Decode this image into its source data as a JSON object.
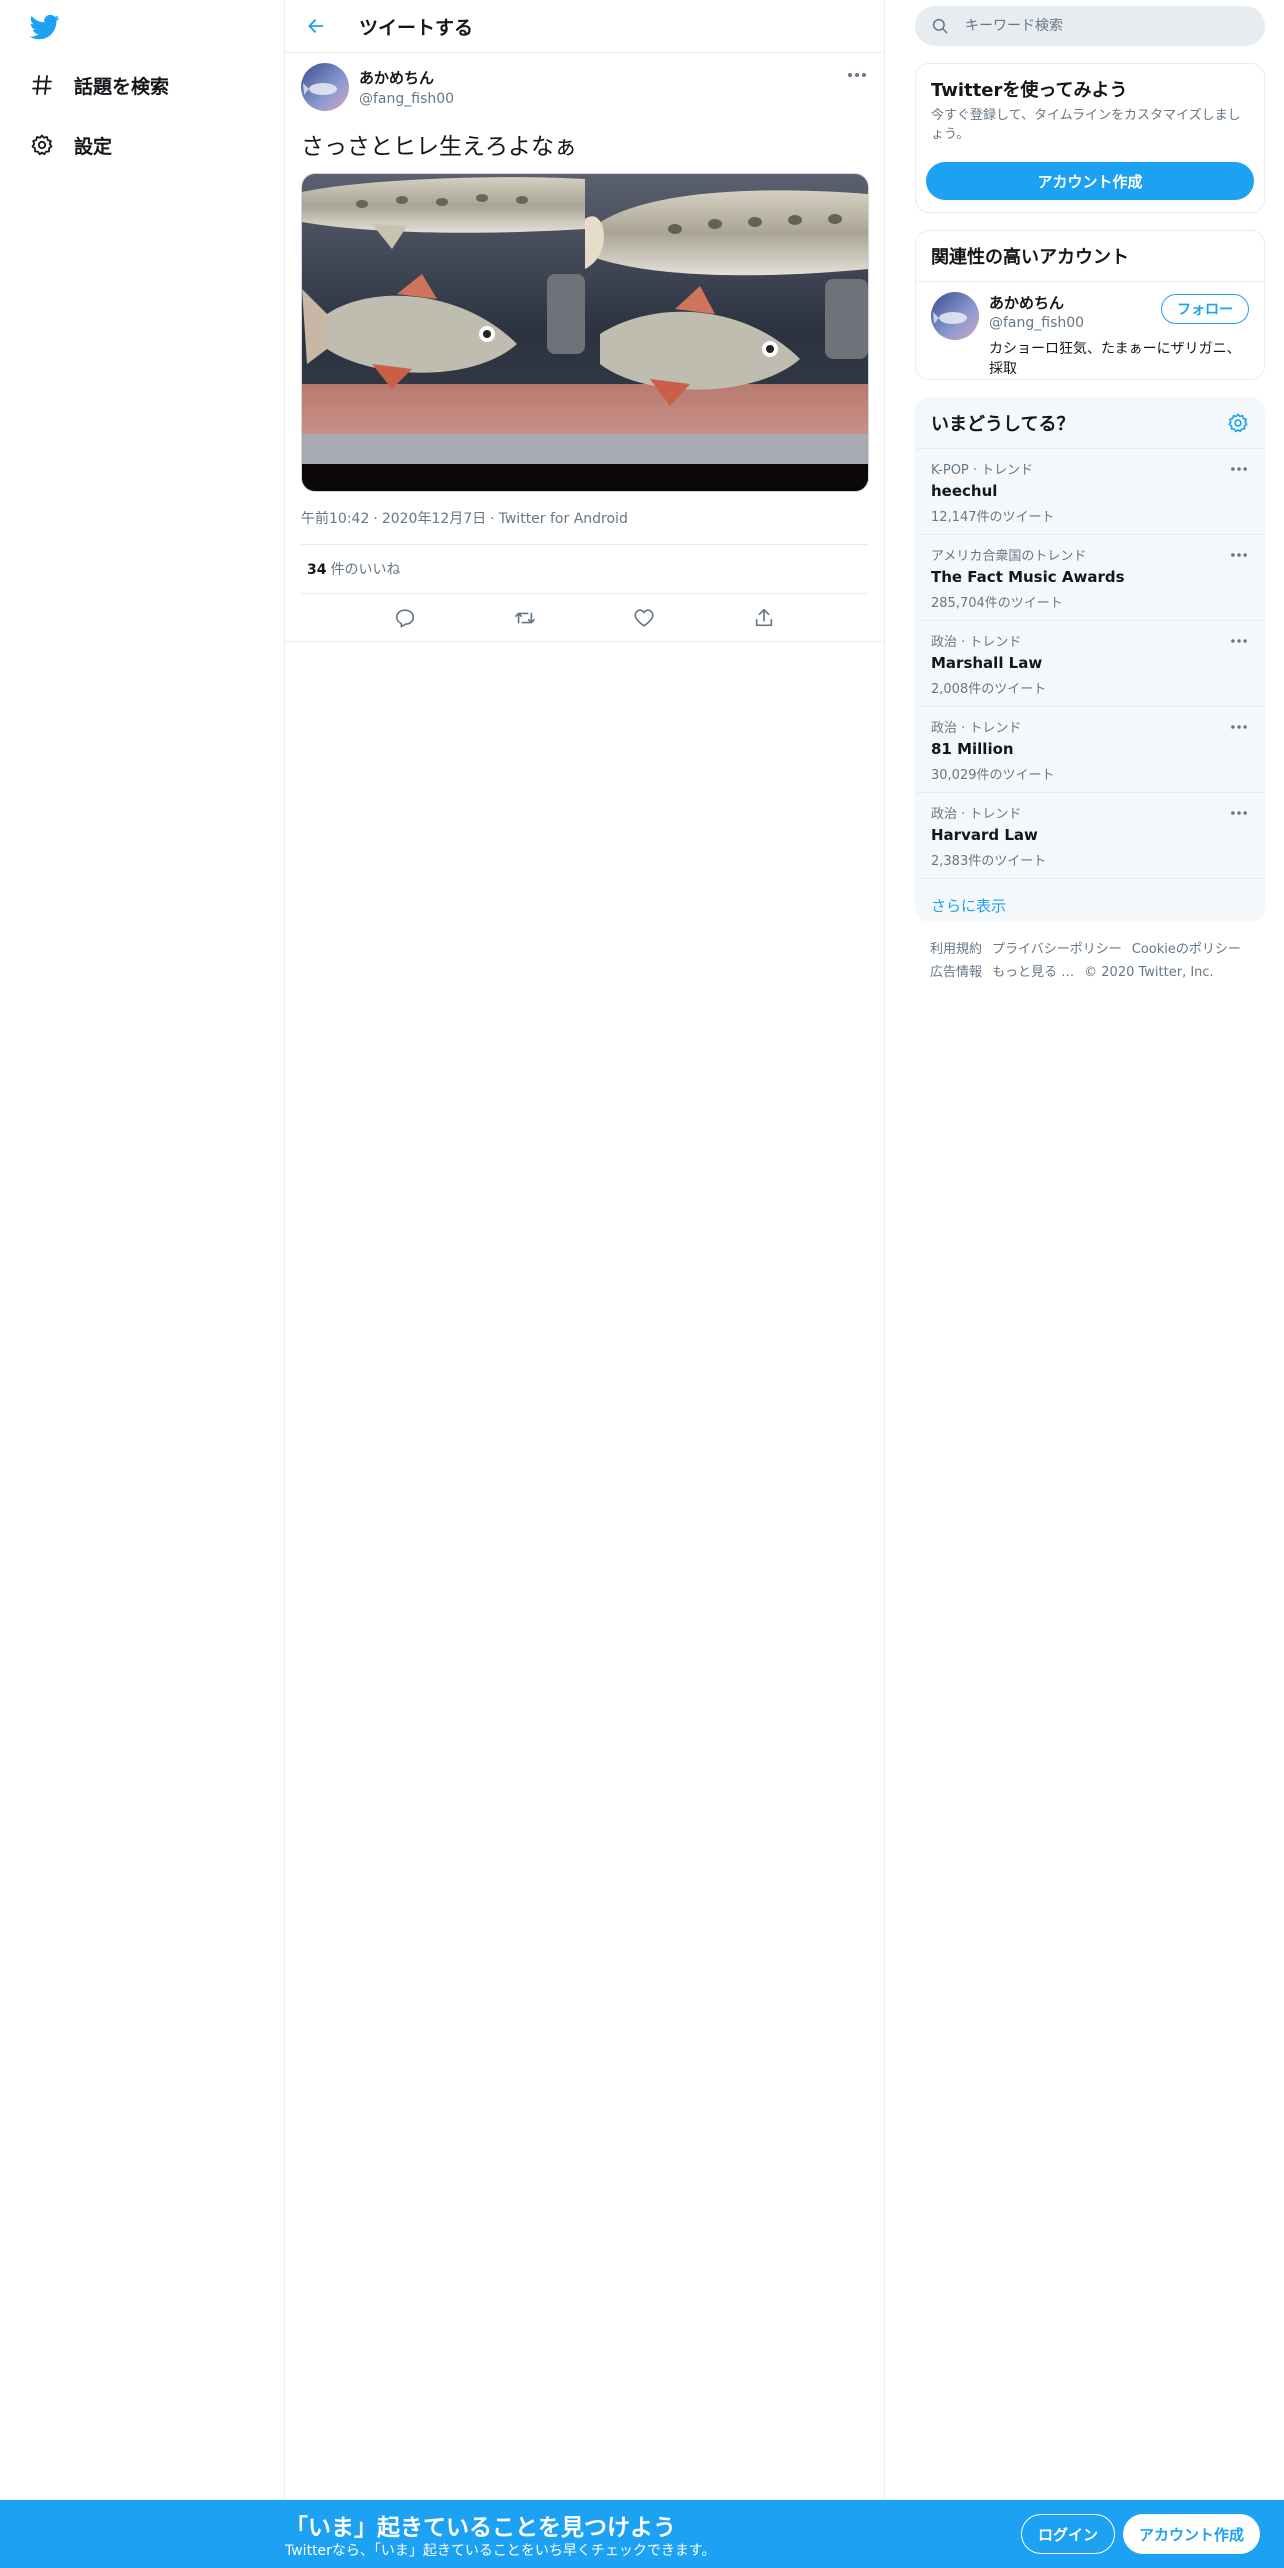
{
  "colors": {
    "accent": "#1da1f2",
    "text": "#14171a",
    "secondary": "#657786",
    "border": "#e6ecf0"
  },
  "nav": {
    "logo_icon": "twitter-bird-icon",
    "items": [
      {
        "label": "話題を検索",
        "icon": "hashtag-icon"
      },
      {
        "label": "設定",
        "icon": "gear-icon"
      }
    ]
  },
  "header": {
    "title": "ツイートする",
    "back_icon": "arrow-left-icon"
  },
  "tweet": {
    "author_name": "あかめちん",
    "author_handle": "@fang_fish00",
    "text": "さっさとヒレ生えろよなぁ",
    "time": "午前10:42",
    "date": "2020年12月7日",
    "source": "Twitter for Android",
    "separator": "·",
    "likes_count": "34",
    "likes_label": "件のいいね",
    "actions": [
      "reply-icon",
      "retweet-icon",
      "like-icon",
      "share-icon"
    ]
  },
  "search": {
    "placeholder": "キーワード検索"
  },
  "signup_card": {
    "title": "Twitterを使ってみよう",
    "desc": "今すぐ登録して、タイムラインをカスタマイズしましょう。",
    "button": "アカウント作成"
  },
  "related": {
    "title": "関連性の高いアカウント",
    "name": "あかめちん",
    "handle": "@fang_fish00",
    "bio": "カショーロ狂気、たまぁーにザリガニ、採取",
    "follow_label": "フォロー"
  },
  "trends": {
    "title": "いまどうしてる？",
    "items": [
      {
        "context": "K-POP · トレンド",
        "name": "heechul",
        "count": "12,147件のツイート"
      },
      {
        "context": "アメリカ合衆国のトレンド",
        "name": "The Fact Music Awards",
        "count": "285,704件のツイート"
      },
      {
        "context": "政治 · トレンド",
        "name": "Marshall Law",
        "count": "2,008件のツイート"
      },
      {
        "context": "政治 · トレンド",
        "name": "81 Million",
        "count": "30,029件のツイート"
      },
      {
        "context": "政治 · トレンド",
        "name": "Harvard Law",
        "count": "2,383件のツイート"
      }
    ],
    "show_more": "さらに表示"
  },
  "footer": {
    "links": [
      "利用規約",
      "プライバシーポリシー",
      "Cookieのポリシー",
      "広告情報",
      "もっと見る …"
    ],
    "copyright": "© 2020 Twitter, Inc."
  },
  "bottom_bar": {
    "title": "「いま」起きていることを見つけよう",
    "subtitle": "Twitterなら、「いま」起きていることをいち早くチェックできます。",
    "login": "ログイン",
    "signup": "アカウント作成"
  }
}
